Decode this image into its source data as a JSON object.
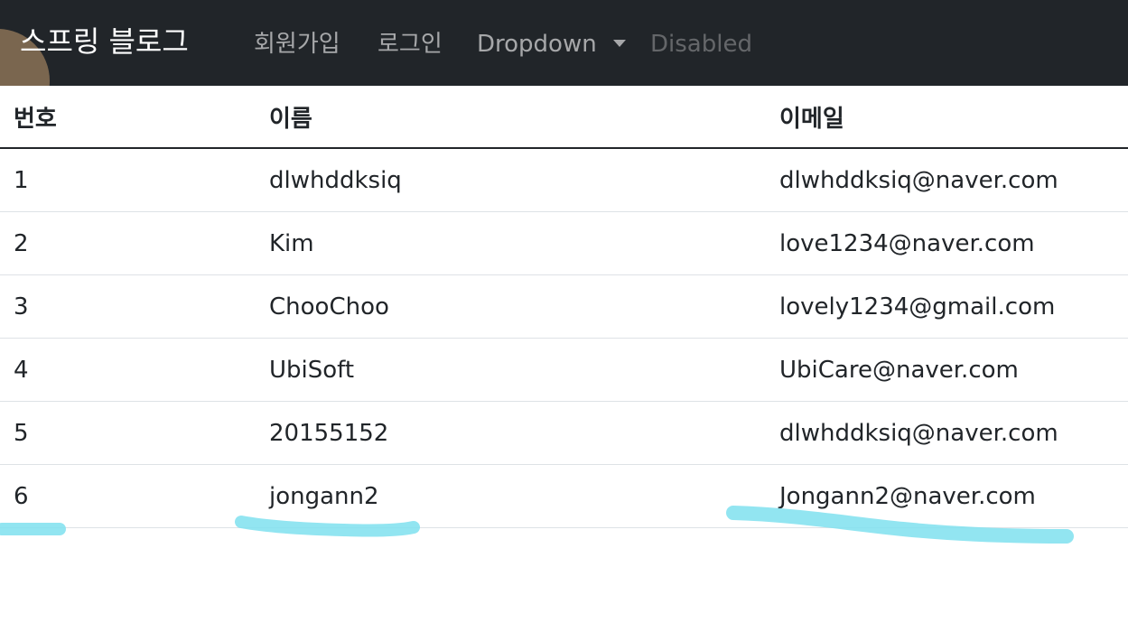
{
  "navbar": {
    "brand": "스프링 블로그",
    "links": [
      {
        "label": "회원가입"
      },
      {
        "label": "로그인"
      },
      {
        "label": "Dropdown"
      },
      {
        "label": "Disabled"
      }
    ]
  },
  "table": {
    "headers": [
      "번호",
      "이름",
      "이메일"
    ],
    "rows": [
      {
        "no": "1",
        "name": "dlwhddksiq",
        "email": "dlwhddksiq@naver.com"
      },
      {
        "no": "2",
        "name": "Kim",
        "email": "love1234@naver.com"
      },
      {
        "no": "3",
        "name": "ChooChoo",
        "email": "lovely1234@gmail.com"
      },
      {
        "no": "4",
        "name": "UbiSoft",
        "email": "UbiCare@naver.com"
      },
      {
        "no": "5",
        "name": "20155152",
        "email": "dlwhddksiq@naver.com"
      },
      {
        "no": "6",
        "name": "jongann2",
        "email": "Jongann2@naver.com"
      }
    ]
  },
  "colors": {
    "navbar_bg": "#212529",
    "highlight": "#7fe0ee"
  }
}
